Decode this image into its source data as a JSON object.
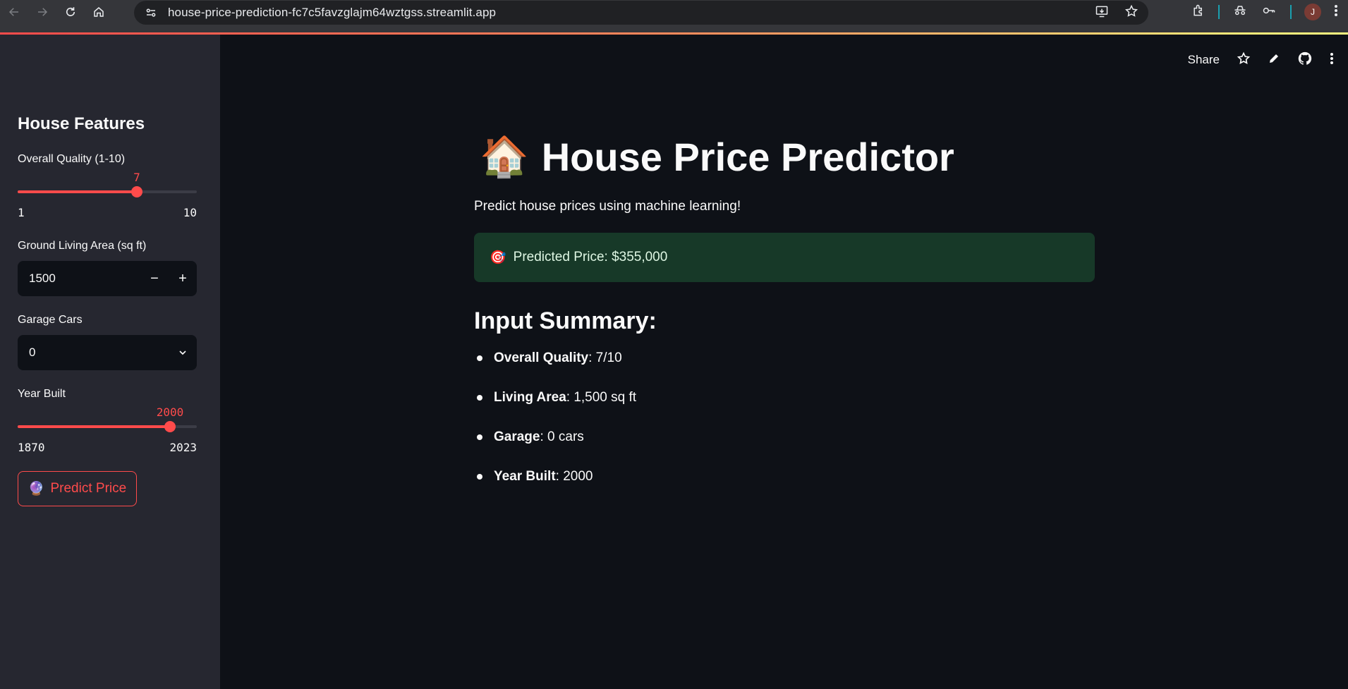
{
  "browser": {
    "url": "house-price-prediction-fc7c5favzglajm64wztgss.streamlit.app",
    "profile_initial": "J"
  },
  "toolbar": {
    "share_label": "Share"
  },
  "sidebar": {
    "title": "House Features",
    "overall_quality": {
      "label": "Overall Quality (1-10)",
      "value": "7",
      "min": "1",
      "max": "10"
    },
    "living_area": {
      "label": "Ground Living Area (sq ft)",
      "value": "1500",
      "minus": "−",
      "plus": "+"
    },
    "garage_cars": {
      "label": "Garage Cars",
      "value": "0"
    },
    "year_built": {
      "label": "Year Built",
      "value": "2000",
      "min": "1870",
      "max": "2023"
    },
    "predict_button": {
      "emoji": "🔮",
      "label": "Predict Price"
    }
  },
  "main": {
    "title_emoji": "🏠",
    "title": "House Price Predictor",
    "subtitle": "Predict house prices using machine learning!",
    "result": {
      "emoji": "🎯",
      "text": "Predicted Price: $355,000"
    },
    "summary_heading": "Input Summary:",
    "summary": [
      {
        "key": "Overall Quality",
        "value": ": 7/10"
      },
      {
        "key": "Living Area",
        "value": ": 1,500 sq ft"
      },
      {
        "key": "Garage",
        "value": ": 0 cars"
      },
      {
        "key": "Year Built",
        "value": ": 2000"
      }
    ]
  },
  "colors": {
    "accent": "#ff4b4b",
    "background": "#0e1117",
    "sidebar": "#262730",
    "success_bg": "#173928"
  }
}
